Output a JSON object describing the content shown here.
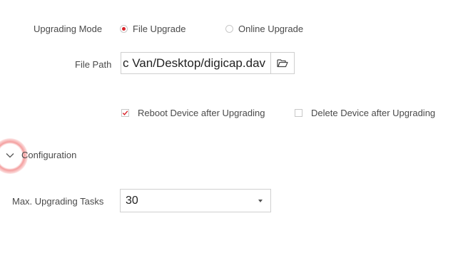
{
  "upgrading_mode": {
    "label": "Upgrading Mode",
    "options": [
      {
        "label": "File Upgrade",
        "selected": true
      },
      {
        "label": "Online Upgrade",
        "selected": false
      }
    ]
  },
  "file_path": {
    "label": "File Path",
    "value": "c Van/Desktop/digicap.dav",
    "browse_icon": "folder-open-icon"
  },
  "options": {
    "reboot_label": "Reboot Device after Upgrading",
    "reboot_checked": true,
    "delete_label": "Delete Device after Upgrading",
    "delete_checked": false
  },
  "configuration": {
    "title": "Configuration",
    "expand_icon": "chevron-down-icon"
  },
  "max_tasks": {
    "label": "Max. Upgrading Tasks",
    "value": "30"
  },
  "colors": {
    "accent": "#d8232a",
    "border": "#cfcfcf",
    "text": "#4a4a4a"
  }
}
